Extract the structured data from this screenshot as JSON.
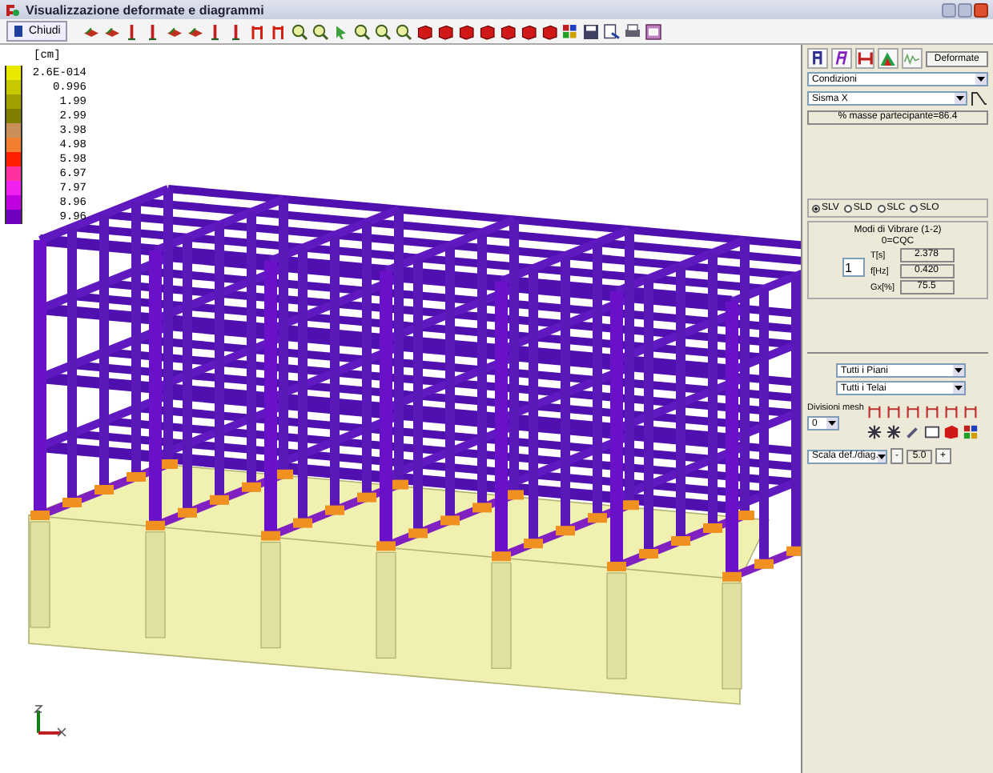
{
  "window": {
    "title": "Visualizzazione deformate e diagrammi"
  },
  "toolbar": {
    "close_button": "Chiudi"
  },
  "legend": {
    "unit": "[cm]",
    "entries": [
      {
        "label": "2.6E-014",
        "color": "#e8e800"
      },
      {
        "label": "0.996",
        "color": "#c8c800"
      },
      {
        "label": "1.99",
        "color": "#a0a000"
      },
      {
        "label": "2.99",
        "color": "#808000"
      },
      {
        "label": "3.98",
        "color": "#c89058"
      },
      {
        "label": "4.98",
        "color": "#f08030"
      },
      {
        "label": "5.98",
        "color": "#ff2000"
      },
      {
        "label": "6.97",
        "color": "#ff30a0"
      },
      {
        "label": "7.97",
        "color": "#f020f0"
      },
      {
        "label": "8.96",
        "color": "#c000e0"
      },
      {
        "label": "9.96",
        "color": "#7000c0"
      }
    ]
  },
  "panel": {
    "mode_button": "Deformate",
    "condition_dropdown": "Condizioni",
    "load_dropdown": "Sisma X",
    "mass_participation": "% masse partecipante=86.4",
    "limit_states": [
      {
        "label": "SLV",
        "selected": true
      },
      {
        "label": "SLD",
        "selected": false
      },
      {
        "label": "SLC",
        "selected": false
      },
      {
        "label": "SLO",
        "selected": false
      }
    ],
    "modes": {
      "title": "Modi di Vibrare (1-2)",
      "subtitle": "0=CQC",
      "mode_spinner": "1",
      "values": [
        {
          "label": "T[s]",
          "value": "2.378"
        },
        {
          "label": "f[Hz]",
          "value": "0.420"
        },
        {
          "label": "Gx[%]",
          "value": "75.5"
        }
      ]
    },
    "floors_dropdown": "Tutti i Piani",
    "frames_dropdown": "Tutti i Telai",
    "mesh_label": "Divisioni mesh",
    "mesh_dropdown": "0",
    "scale_dropdown": "Scala def./diag.",
    "scale_minus": "-",
    "scale_value": "5.0",
    "scale_plus": "+"
  }
}
